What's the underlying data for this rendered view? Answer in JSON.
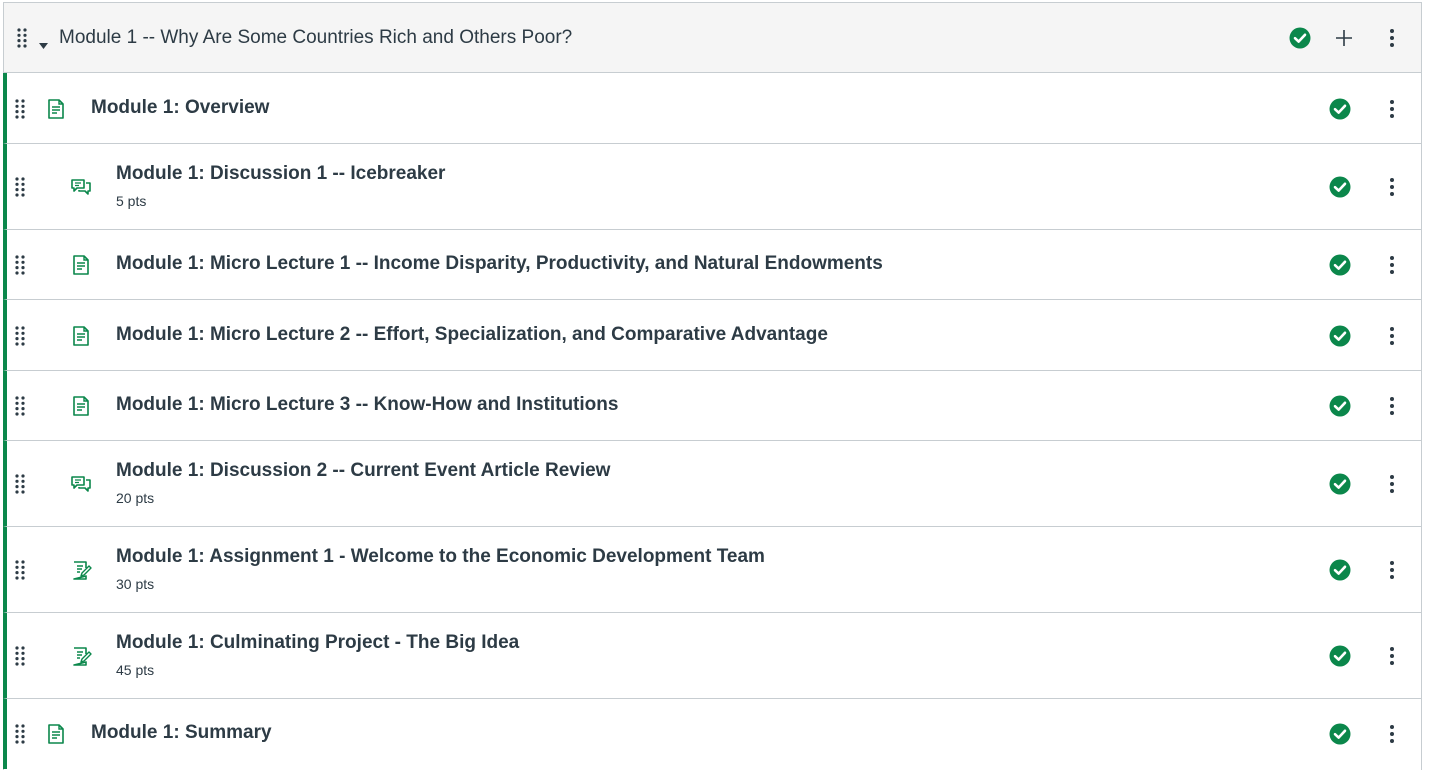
{
  "module": {
    "title": "Module 1 -- Why Are Some Countries Rich and Others Poor?",
    "status_icon": "published-check-icon",
    "add_icon": "plus-icon",
    "menu_icon": "kebab-icon"
  },
  "colors": {
    "accent_green": "#0b874b",
    "header_bg": "#f5f5f5",
    "border": "#c7cdd1",
    "text": "#2d3b45"
  },
  "items": [
    {
      "title": "Module 1: Overview",
      "points": "",
      "type": "page-icon",
      "indent": 0
    },
    {
      "title": "Module 1: Discussion 1 -- Icebreaker",
      "points": "5 pts",
      "type": "discussion-icon",
      "indent": 1
    },
    {
      "title": "Module 1: Micro Lecture 1 -- Income Disparity, Productivity, and Natural Endowments",
      "points": "",
      "type": "page-icon",
      "indent": 1
    },
    {
      "title": "Module 1: Micro Lecture 2 -- Effort, Specialization, and Comparative Advantage",
      "points": "",
      "type": "page-icon",
      "indent": 1
    },
    {
      "title": "Module 1: Micro Lecture 3 -- Know-How and Institutions",
      "points": "",
      "type": "page-icon",
      "indent": 1
    },
    {
      "title": "Module 1: Discussion 2 -- Current Event Article Review",
      "points": "20 pts",
      "type": "discussion-icon",
      "indent": 1
    },
    {
      "title": "Module 1: Assignment 1 - Welcome to the Economic Development Team",
      "points": "30 pts",
      "type": "assignment-icon",
      "indent": 1
    },
    {
      "title": "Module 1: Culminating Project - The Big Idea",
      "points": "45 pts",
      "type": "assignment-icon",
      "indent": 1
    },
    {
      "title": "Module 1: Summary",
      "points": "",
      "type": "page-icon",
      "indent": 0
    }
  ]
}
